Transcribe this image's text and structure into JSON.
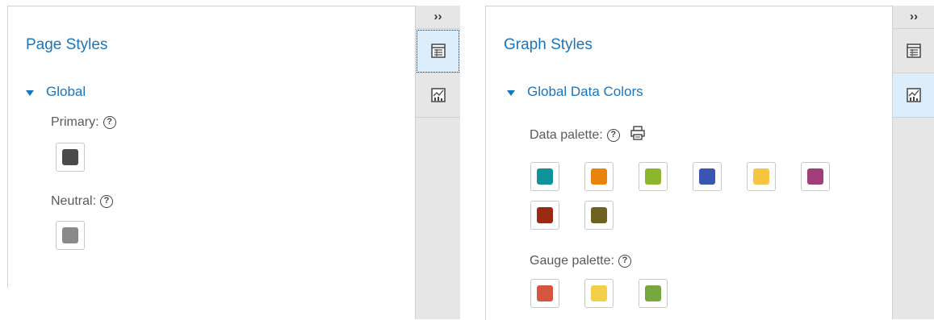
{
  "left": {
    "title": "Page Styles",
    "section": "Global",
    "fields": [
      {
        "label": "Primary:",
        "color": "#4a4a4a"
      },
      {
        "label": "Neutral:",
        "color": "#8a8a8a"
      }
    ]
  },
  "right": {
    "title": "Graph Styles",
    "section": "Global Data Colors",
    "data_palette_label": "Data palette:",
    "data_palette": [
      "#10929a",
      "#e8830e",
      "#8eb52e",
      "#3a55b4",
      "#f7c540",
      "#a13f7c",
      "#9b2a13",
      "#6e6223"
    ],
    "gauge_palette_label": "Gauge palette:",
    "gauge_palette": [
      "#d6553f",
      "#f2cf48",
      "#77a83f"
    ]
  },
  "sidebar": {
    "collapse_label": "››",
    "tabs": [
      {
        "name": "page-styles-tab",
        "icon": "table-icon"
      },
      {
        "name": "graph-styles-tab",
        "icon": "graph-icon"
      }
    ]
  },
  "help_glyph": "?"
}
